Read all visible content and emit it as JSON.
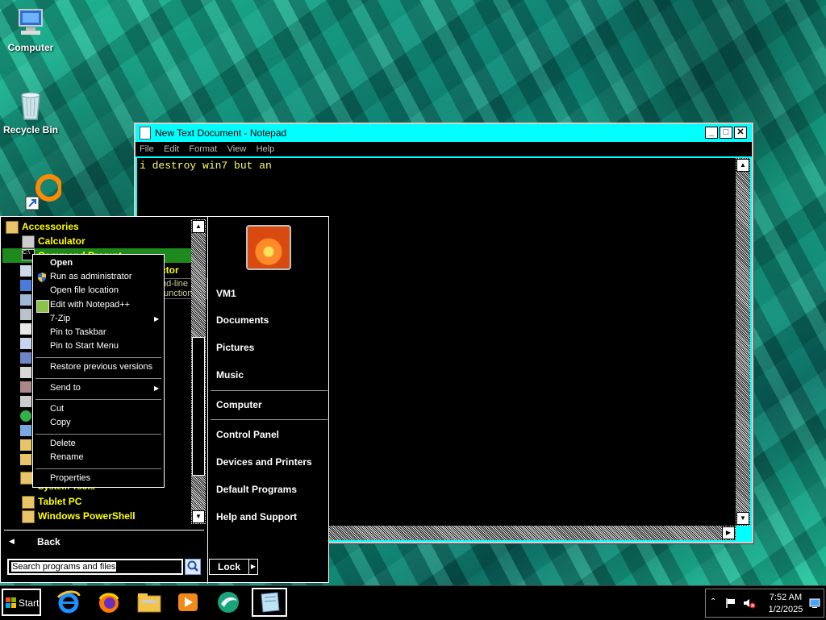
{
  "desktop": {
    "icons": [
      {
        "label": "Computer"
      },
      {
        "label": "Recycle Bin"
      },
      {
        "label": ""
      }
    ]
  },
  "notepad": {
    "title": "New Text Document - Notepad",
    "menu": [
      "File",
      "Edit",
      "Format",
      "View",
      "Help"
    ],
    "content": "i destroy win7 but an"
  },
  "start_menu": {
    "programs": [
      {
        "label": "Accessories",
        "icon": "folder-icon"
      },
      {
        "label": "Calculator",
        "icon": "calculator-icon"
      },
      {
        "label": "Command Prompt",
        "icon": "cmd-icon"
      },
      {
        "label": "ctor",
        "icon": "app-icon"
      },
      {
        "label": "System Tools",
        "icon": "folder-icon"
      },
      {
        "label": "Tablet PC",
        "icon": "folder-icon"
      },
      {
        "label": "Windows PowerShell",
        "icon": "folder-icon"
      }
    ],
    "tooltip_fragment": "nd-line functions.",
    "back_label": "Back",
    "search_placeholder": "Search programs and files",
    "lock_label": "Lock",
    "right_items": {
      "user": "VM1",
      "documents": "Documents",
      "pictures": "Pictures",
      "music": "Music",
      "computer": "Computer",
      "control_panel": "Control Panel",
      "devices": "Devices and Printers",
      "default_programs": "Default Programs",
      "help": "Help and Support"
    }
  },
  "context_menu": {
    "open": "Open",
    "run_admin": "Run as administrator",
    "open_location": "Open file location",
    "edit_npp": "Edit with Notepad++",
    "zip": "7-Zip",
    "pin_taskbar": "Pin to Taskbar",
    "pin_start": "Pin to Start Menu",
    "restore": "Restore previous versions",
    "send_to": "Send to",
    "cut": "Cut",
    "copy": "Copy",
    "delete": "Delete",
    "rename": "Rename",
    "properties": "Properties"
  },
  "taskbar": {
    "start_label": "Start",
    "pinned": [
      "internet-explorer-icon",
      "firefox-icon",
      "file-explorer-icon",
      "media-player-icon",
      "app-icon",
      "notepad-icon"
    ],
    "time": "7:52 AM",
    "date": "1/2/2025"
  },
  "colors": {
    "notepad_title": "#00ffff",
    "program_text": "#ffff00",
    "editor_text": "#ffff66"
  }
}
